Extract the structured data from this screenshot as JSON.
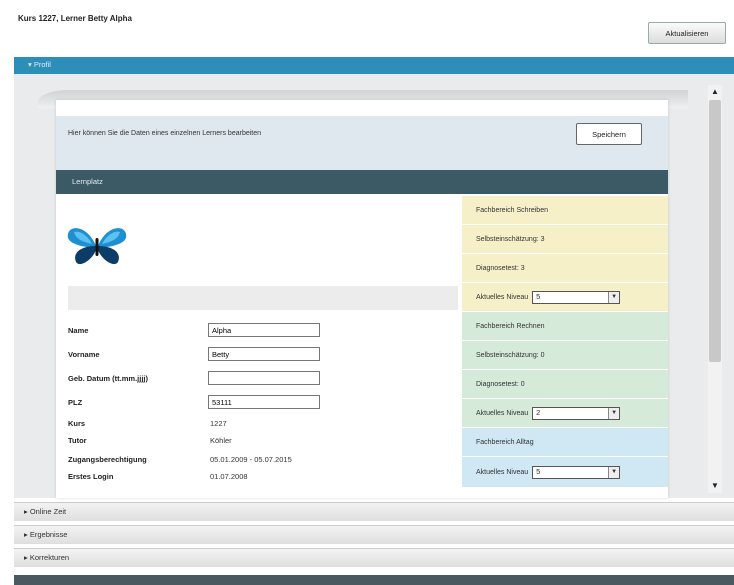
{
  "header": {
    "title": "Kurs 1227, Lerner Betty Alpha",
    "refresh_label": "Aktualisieren"
  },
  "profil": {
    "label": "▾ Profil"
  },
  "info": {
    "text": "Hier können Sie die Daten eines einzelnen Lerners bearbeiten",
    "save_label": "Speichern"
  },
  "section": {
    "title": "Lernplatz"
  },
  "icons": {
    "butterfly": "butterfly-logo"
  },
  "fields": {
    "name": {
      "label": "Name",
      "value": "Alpha"
    },
    "vorname": {
      "label": "Vorname",
      "value": "Betty"
    },
    "geb": {
      "label": "Geb. Datum (tt.mm.jjjj)",
      "value": ""
    },
    "plz": {
      "label": "PLZ",
      "value": "53111"
    },
    "kurs": {
      "label": "Kurs",
      "value": "1227"
    },
    "tutor": {
      "label": "Tutor",
      "value": "Köhler"
    },
    "zugang": {
      "label": "Zugangsberechtigung",
      "value": "05.01.2009 - 05.07.2015"
    },
    "login": {
      "label": "Erstes Login",
      "value": "01.07.2008"
    }
  },
  "right": {
    "schreiben": {
      "title": "Fachbereich Schreiben",
      "selbst": "Selbsteinschätzung: 3",
      "diag": "Diagnosetest: 3",
      "niveau_label": "Aktuelles Niveau",
      "niveau": "5"
    },
    "rechnen": {
      "title": "Fachbereich Rechnen",
      "selbst": "Selbsteinschätzung: 0",
      "diag": "Diagnosetest: 0",
      "niveau_label": "Aktuelles Niveau",
      "niveau": "2"
    },
    "alltag": {
      "title": "Fachbereich Alltag",
      "niveau_label": "Aktuelles Niveau",
      "niveau": "5"
    }
  },
  "accordion": {
    "online": "▸ Online Zeit",
    "ergebnisse": "▸ Ergebnisse",
    "korrekturen": "▸ Korrekturen"
  },
  "colors": {
    "accent": "#2d8fb8",
    "section": "#3b5a66",
    "yellow": "#f6f0c8",
    "green": "#d6ead9",
    "blue": "#cfe8f4"
  }
}
